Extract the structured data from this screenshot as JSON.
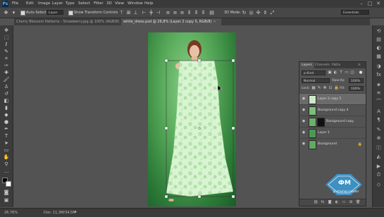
{
  "menubar": {
    "logo": "Ps",
    "items": [
      "File",
      "Edit",
      "Image",
      "Layer",
      "Type",
      "Select",
      "Filter",
      "3D",
      "View",
      "Window",
      "Help"
    ],
    "window_controls": [
      "–",
      "□",
      "✕"
    ]
  },
  "options_bar": {
    "auto_select_label": "Auto-Select:",
    "auto_select_value": "Layer",
    "show_transform_label": "Show Transform Controls",
    "mode_label": "3D Mode:",
    "workspace": "Essentials"
  },
  "tabs": [
    {
      "label": "Cherry Blossom Patterns - Strawberry.jpg @ 100% (RGB/8)",
      "close": "×"
    },
    {
      "label": "white_dress.psd @ 26,8% (Layer 2 copy 5, RGB/8)",
      "close": "×"
    }
  ],
  "layers_panel": {
    "tabs": [
      "Layers",
      "Channels",
      "Paths"
    ],
    "filter_kind": "ρ Kind",
    "blend_mode": "Normal",
    "opacity_label": "Opacity:",
    "opacity_value": "100%",
    "lock_label": "Lock:",
    "fill_label": "Fill:",
    "fill_value": "100%",
    "layers": [
      {
        "name": "Layer 2 copy 5",
        "selected": true,
        "thumb_color": "#cde9c6",
        "has_mask": false,
        "locked": false
      },
      {
        "name": "Background copy 4",
        "selected": false,
        "thumb_color": "#7bbf78",
        "has_mask": false,
        "locked": false
      },
      {
        "name": "Background copy",
        "selected": false,
        "thumb_color": "#6ab06a",
        "has_mask": true,
        "locked": false
      },
      {
        "name": "Layer 1",
        "selected": false,
        "thumb_color": "#4c9a52",
        "has_mask": false,
        "locked": false
      },
      {
        "name": "Background",
        "selected": false,
        "thumb_color": "#5eaa60",
        "has_mask": false,
        "locked": true
      }
    ],
    "footer_icons": [
      "link-icon",
      "fx-icon",
      "mask-icon",
      "adjustment-icon",
      "folder-icon",
      "new-layer-icon",
      "trash-icon"
    ]
  },
  "status_bar": {
    "zoom": "26,76%",
    "doc": "Doc: 11,3M/34,5M"
  },
  "watermark": {
    "logo": "ФМ",
    "caption": "photoshop-master"
  },
  "colors": {
    "accent": "#3c9bd5",
    "canvas_green": "#5cae5e",
    "dress_fill": "#d9f4d2"
  }
}
